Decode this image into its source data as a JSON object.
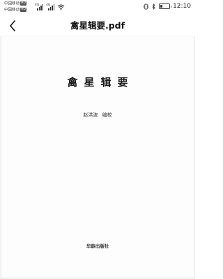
{
  "status_bar": {
    "carrier_1": "中国移动",
    "carrier_2": "中国移动",
    "hd_badge": "HD",
    "network_1": "4G",
    "network_2": "4G",
    "clock": "12:10",
    "battery_level": 0.25,
    "icons": [
      "signal-icon",
      "wifi-icon",
      "vibrate-icon",
      "bluetooth-icon",
      "battery-icon"
    ]
  },
  "app_bar": {
    "back_icon": "chevron-left-icon",
    "title": "禽星辑要.pdf"
  },
  "document": {
    "book_title": "禽星辑要",
    "editor": "赵洪波  编校",
    "publisher": "华龄出版社"
  }
}
